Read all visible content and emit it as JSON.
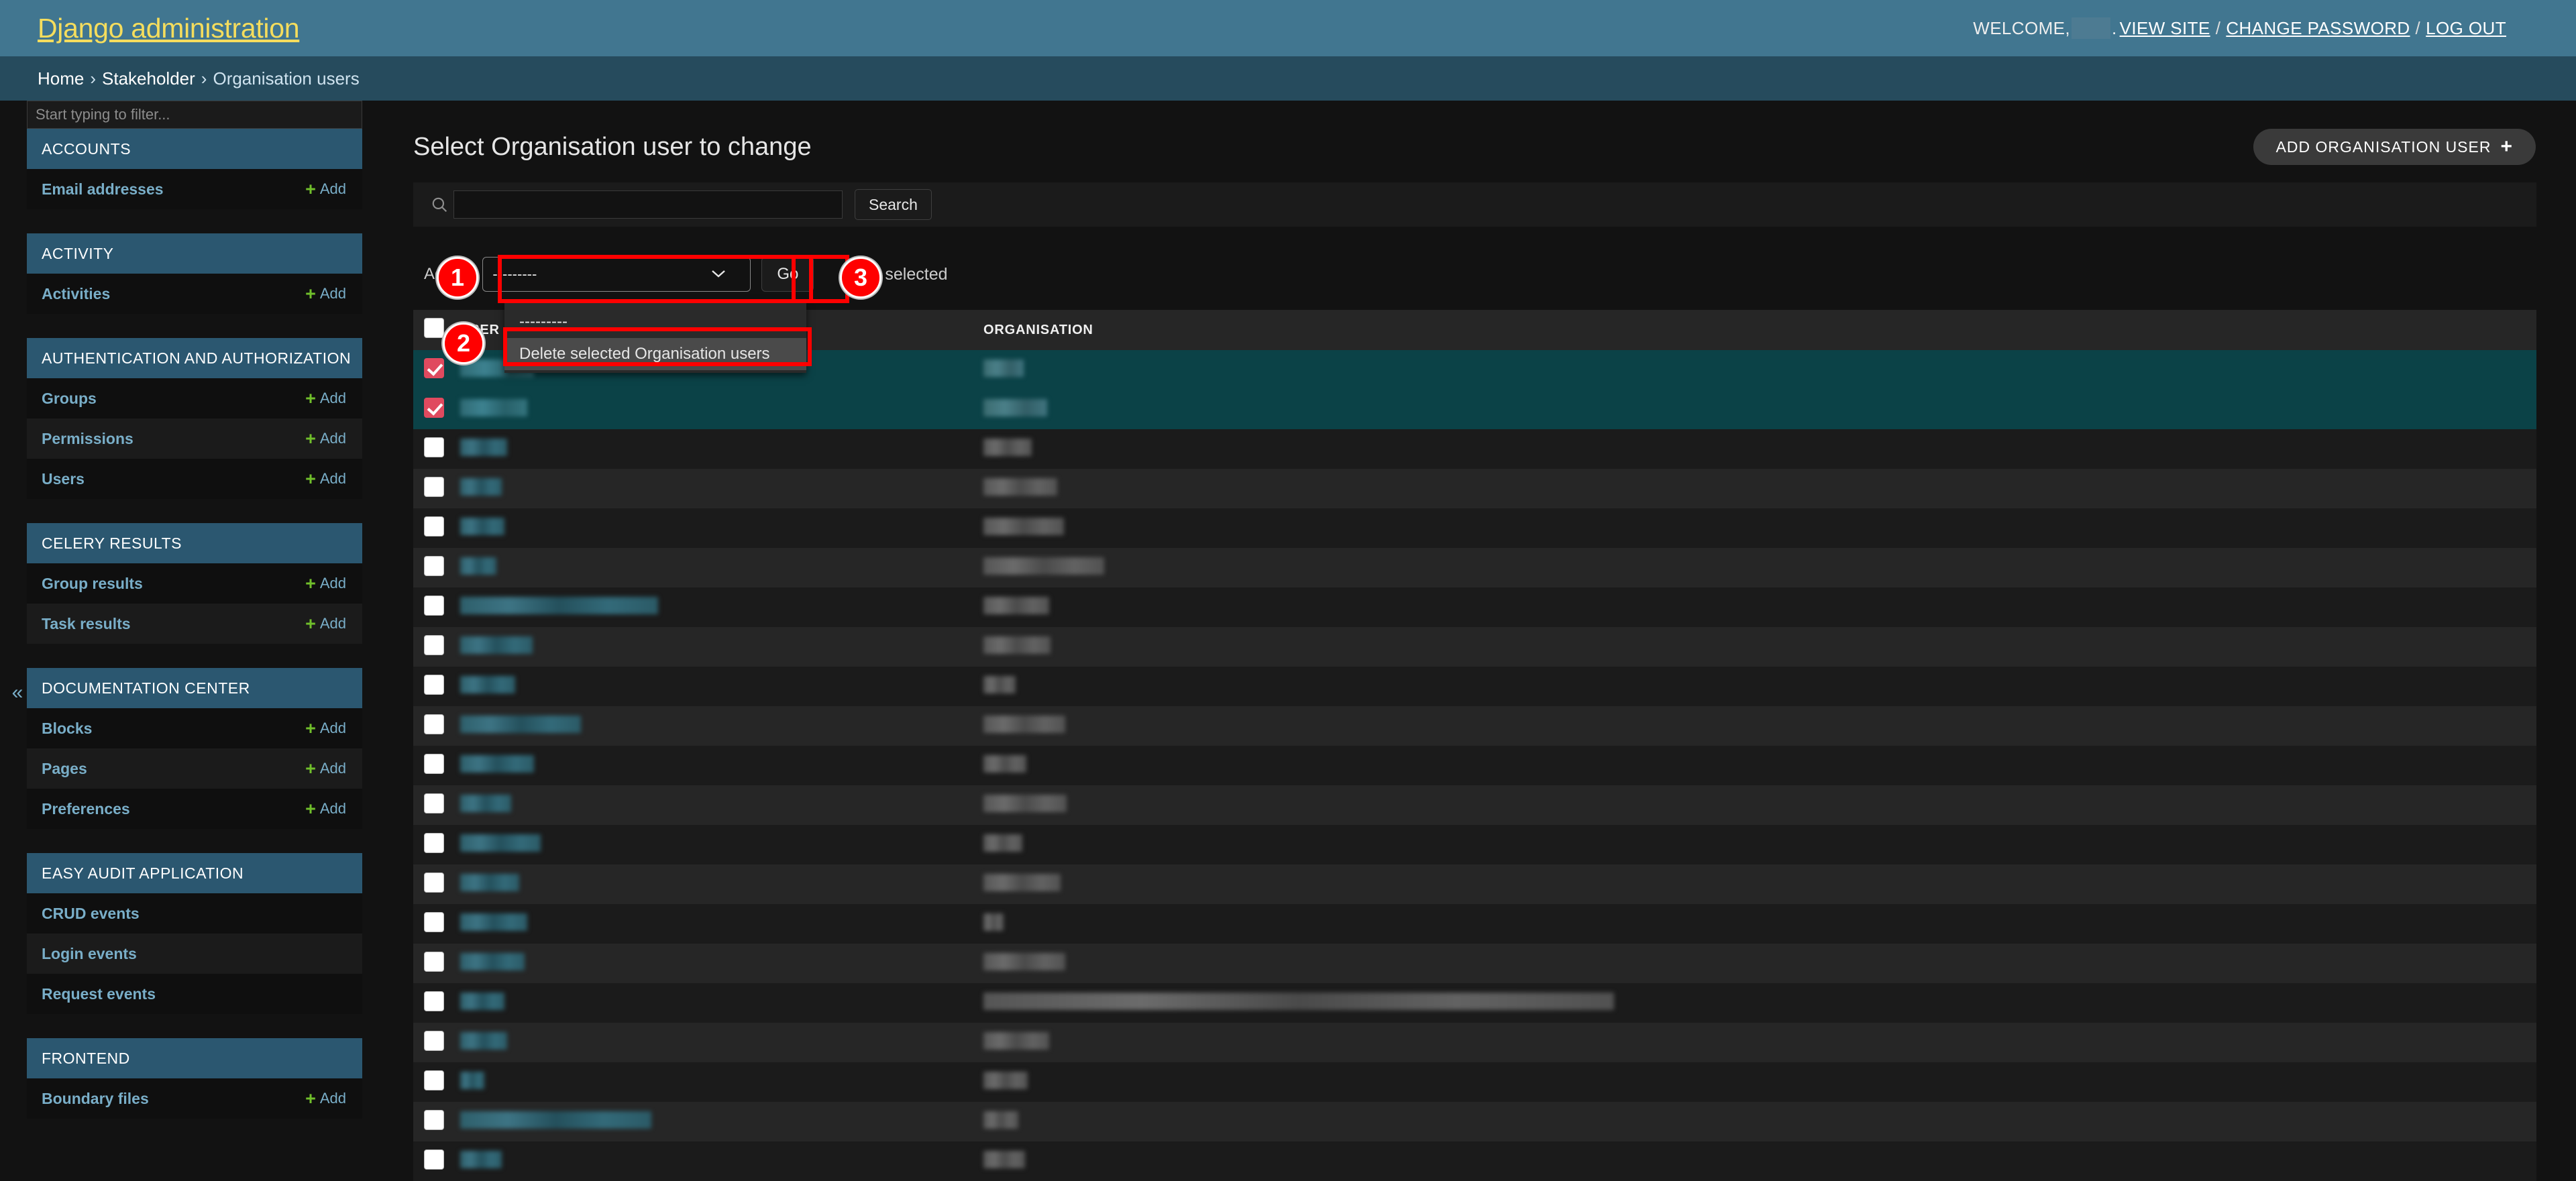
{
  "header": {
    "site_title": "Django administration",
    "welcome_prefix": "WELCOME,",
    "welcome_suffix": ".",
    "view_site": "VIEW SITE",
    "change_password": "CHANGE PASSWORD",
    "log_out": "LOG OUT",
    "separator": "/"
  },
  "breadcrumbs": {
    "home": "Home",
    "app": "Stakeholder",
    "current": "Organisation users",
    "separator": "›"
  },
  "sidebar": {
    "filter_placeholder": "Start typing to filter...",
    "collapse_icon": "«",
    "add_label": "Add",
    "apps": [
      {
        "caption": "ACCOUNTS",
        "models": [
          {
            "name": "Email addresses",
            "add": true
          }
        ]
      },
      {
        "caption": "ACTIVITY",
        "models": [
          {
            "name": "Activities",
            "add": true
          }
        ]
      },
      {
        "caption": "AUTHENTICATION AND AUTHORIZATION",
        "models": [
          {
            "name": "Groups",
            "add": true
          },
          {
            "name": "Permissions",
            "add": true
          },
          {
            "name": "Users",
            "add": true
          }
        ]
      },
      {
        "caption": "CELERY RESULTS",
        "models": [
          {
            "name": "Group results",
            "add": true
          },
          {
            "name": "Task results",
            "add": true
          }
        ]
      },
      {
        "caption": "DOCUMENTATION CENTER",
        "models": [
          {
            "name": "Blocks",
            "add": true
          },
          {
            "name": "Pages",
            "add": true
          },
          {
            "name": "Preferences",
            "add": true
          }
        ]
      },
      {
        "caption": "EASY AUDIT APPLICATION",
        "models": [
          {
            "name": "CRUD events",
            "add": false
          },
          {
            "name": "Login events",
            "add": false
          },
          {
            "name": "Request events",
            "add": false
          }
        ]
      },
      {
        "caption": "FRONTEND",
        "models": [
          {
            "name": "Boundary files",
            "add": true
          }
        ]
      }
    ]
  },
  "main": {
    "page_title": "Select Organisation user to change",
    "add_button": "ADD ORGANISATION USER",
    "add_button_icon": "+",
    "search": {
      "value": "",
      "placeholder": "",
      "submit_label": "Search",
      "icon": "search-icon"
    },
    "actions": {
      "label": "Action:",
      "selected_option": "---------",
      "go_label": "Go",
      "counter_text": "selected",
      "chevron": "⌄",
      "options": [
        {
          "label": "---------",
          "selected": false
        },
        {
          "label": "Delete selected Organisation users",
          "selected": true
        }
      ]
    },
    "table": {
      "columns": [
        "USER",
        "ORGANISATION"
      ],
      "select_all_checked": false,
      "rows": [
        {
          "selected": true,
          "user_w": 110,
          "org_w": 60
        },
        {
          "selected": true,
          "user_w": 100,
          "org_w": 95
        },
        {
          "selected": false,
          "user_w": 70,
          "org_w": 72
        },
        {
          "selected": false,
          "user_w": 62,
          "org_w": 110
        },
        {
          "selected": false,
          "user_w": 66,
          "org_w": 120
        },
        {
          "selected": false,
          "user_w": 54,
          "org_w": 180
        },
        {
          "selected": false,
          "user_w": 295,
          "org_w": 98
        },
        {
          "selected": false,
          "user_w": 108,
          "org_w": 100
        },
        {
          "selected": false,
          "user_w": 82,
          "org_w": 48
        },
        {
          "selected": false,
          "user_w": 180,
          "org_w": 122
        },
        {
          "selected": false,
          "user_w": 110,
          "org_w": 64
        },
        {
          "selected": false,
          "user_w": 76,
          "org_w": 124
        },
        {
          "selected": false,
          "user_w": 120,
          "org_w": 58
        },
        {
          "selected": false,
          "user_w": 88,
          "org_w": 115
        },
        {
          "selected": false,
          "user_w": 100,
          "org_w": 30
        },
        {
          "selected": false,
          "user_w": 96,
          "org_w": 122
        },
        {
          "selected": false,
          "user_w": 66,
          "org_w": 940
        },
        {
          "selected": false,
          "user_w": 70,
          "org_w": 98
        },
        {
          "selected": false,
          "user_w": 36,
          "org_w": 66
        },
        {
          "selected": false,
          "user_w": 285,
          "org_w": 52
        },
        {
          "selected": false,
          "user_w": 62,
          "org_w": 62
        }
      ]
    }
  },
  "annotations": {
    "markers": [
      {
        "id": "1",
        "target": "action-select"
      },
      {
        "id": "2",
        "target": "delete-action-option"
      },
      {
        "id": "3",
        "target": "go-button"
      }
    ]
  },
  "colors": {
    "brand_header": "#417690",
    "brand_title": "#f5dd5d",
    "breadcrumb_bg": "#264b5d",
    "link": "#79aec8",
    "add_plus": "#70bf2b",
    "selected_row": "#0b4247",
    "checked_box": "#e04a5f",
    "annotation": "#ff0000"
  }
}
